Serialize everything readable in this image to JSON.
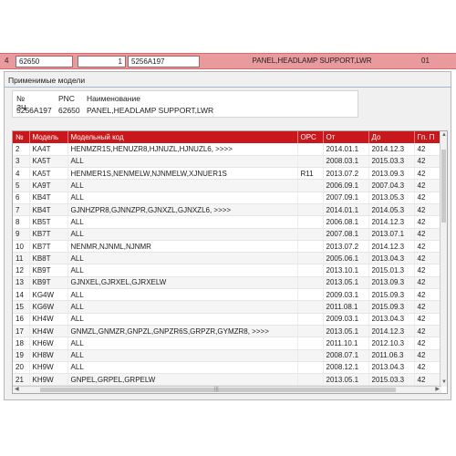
{
  "topbar": {
    "row_num": "4",
    "pnc": "62650",
    "qty": "1",
    "part_no": "5256A197",
    "part_name": "PANEL,HEADLAMP SUPPORT,LWR",
    "page": "01"
  },
  "panel": {
    "title": "Применимые модели",
    "info_headers": [
      "№ ЗЧ",
      "PNC",
      "Наименование"
    ],
    "info_values": [
      "5256A197",
      "62650",
      "PANEL,HEADLAMP SUPPORT,LWR"
    ]
  },
  "grid": {
    "columns": [
      "№",
      "Модель",
      "Модельный код",
      "ОРС",
      "От",
      "До",
      "Гп. П"
    ],
    "rows": [
      [
        "2",
        "KA4T",
        "HENMZR1S,HENUZR8,HJNUZL,HJNUZL6,  >>>>",
        "",
        "2014.01.1",
        "2014.12.3",
        "42"
      ],
      [
        "3",
        "KA5T",
        "ALL",
        "",
        "2008.03.1",
        "2015.03.3",
        "42"
      ],
      [
        "4",
        "KA5T",
        "HENMER1S,NENMELW,NJNMELW,XJNUER1S",
        "R11",
        "2013.07.2",
        "2013.09.3",
        "42"
      ],
      [
        "5",
        "KA9T",
        "ALL",
        "",
        "2006.09.1",
        "2007.04.3",
        "42"
      ],
      [
        "6",
        "KB4T",
        "ALL",
        "",
        "2007.09.1",
        "2013.05.3",
        "42"
      ],
      [
        "7",
        "KB4T",
        "GJNHZPR8,GJNNZPR,GJNXZL,GJNXZL6,  >>>>",
        "",
        "2014.01.1",
        "2014.05.3",
        "42"
      ],
      [
        "8",
        "KB5T",
        "ALL",
        "",
        "2006.08.1",
        "2014.12.3",
        "42"
      ],
      [
        "9",
        "KB7T",
        "ALL",
        "",
        "2007.08.1",
        "2013.07.1",
        "42"
      ],
      [
        "10",
        "KB7T",
        "NENMR,NJNML,NJNMR",
        "",
        "2013.07.2",
        "2014.12.3",
        "42"
      ],
      [
        "11",
        "KB8T",
        "ALL",
        "",
        "2005.06.1",
        "2013.04.3",
        "42"
      ],
      [
        "12",
        "KB9T",
        "ALL",
        "",
        "2013.10.1",
        "2015.01.3",
        "42"
      ],
      [
        "13",
        "KB9T",
        "GJNXEL,GJRXEL,GJRXELW",
        "",
        "2013.05.1",
        "2013.09.3",
        "42"
      ],
      [
        "14",
        "KG4W",
        "ALL",
        "",
        "2009.03.1",
        "2015.09.3",
        "42"
      ],
      [
        "15",
        "KG6W",
        "ALL",
        "",
        "2011.08.1",
        "2015.09.3",
        "42"
      ],
      [
        "16",
        "KH4W",
        "ALL",
        "",
        "2009.03.1",
        "2013.04.3",
        "42"
      ],
      [
        "17",
        "KH4W",
        "GNMZL,GNMZR,GNPZL,GNPZR6S,GRPZR,GYMZR8,  >>>>",
        "",
        "2013.05.1",
        "2014.12.3",
        "42"
      ],
      [
        "18",
        "KH6W",
        "ALL",
        "",
        "2011.10.1",
        "2012.10.3",
        "42"
      ],
      [
        "19",
        "KH8W",
        "ALL",
        "",
        "2008.07.1",
        "2011.06.3",
        "42"
      ],
      [
        "20",
        "KH9W",
        "ALL",
        "",
        "2008.12.1",
        "2013.04.3",
        "42"
      ],
      [
        "21",
        "KH9W",
        "GNPEL,GRPEL,GRPELW",
        "",
        "2013.05.1",
        "2015.03.3",
        "42"
      ]
    ]
  },
  "colors": {
    "topbar_bg": "#e99a9d",
    "header_bg": "#c8181c",
    "header_text": "#ffffff"
  }
}
